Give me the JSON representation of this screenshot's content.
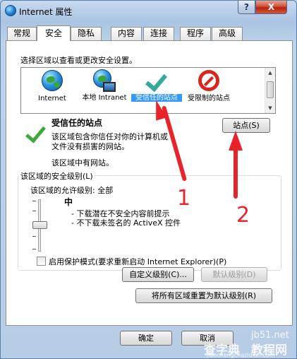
{
  "window": {
    "title": "Internet 属性",
    "help": "?",
    "close": "X"
  },
  "tabs": [
    "常规",
    "安全",
    "隐私",
    "内容",
    "连接",
    "程序",
    "高级"
  ],
  "zones": {
    "instruction": "选择区域以查看或更改安全设置。",
    "items": [
      {
        "label": "Internet",
        "icon": "globe-icon"
      },
      {
        "label": "本地 Intranet",
        "icon": "intranet-icon"
      },
      {
        "label": "受信任的站点",
        "icon": "trusted-check-icon"
      },
      {
        "label": "受限制的站点",
        "icon": "restricted-icon"
      }
    ]
  },
  "selected_zone": {
    "title": "受信任的站点",
    "description_line1": "该区域包含你信任对你的计算机或",
    "description_line2": "文件没有损害的网站。",
    "note": "该区域中有网站。",
    "sites_button": "站点(S)"
  },
  "security_level": {
    "group_title": "该区域的安全级别(L)",
    "allowed": "该区域的允许级别: 全部",
    "level": "中",
    "bullet1": "- 下载潜在不安全内容前提示",
    "bullet2": "- 不下载未签名的 ActiveX 控件",
    "slider_level": 0.5,
    "protected_mode": "启用保护模式(要求重新启动 Internet Explorer)(P)",
    "custom_button": "自定义级别(C)...",
    "default_button": "默认级别(D)"
  },
  "reset_button": "将所有区域重置为默认级别(R)",
  "footer": {
    "ok": "确定",
    "cancel": "取消"
  },
  "annotations": {
    "one": "1",
    "two": "2"
  },
  "watermark": {
    "site": "jb51.net",
    "line1": "查字典",
    "line2": "教程网",
    "line3": "jiaochengchazidian.com"
  },
  "colors": {
    "annotation": "#e8232a",
    "selection": "#3399ff",
    "check": "#34a89a"
  }
}
